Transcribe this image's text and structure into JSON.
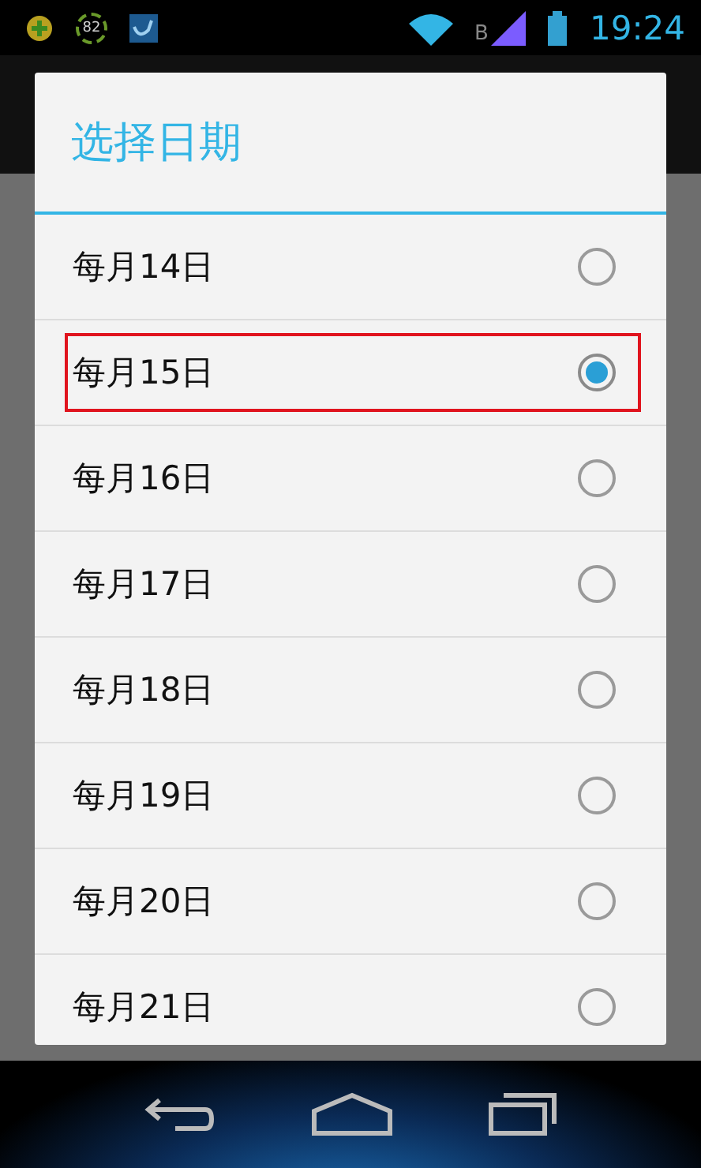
{
  "status_bar": {
    "battery_badge": "82",
    "network_letter": "B",
    "time": "19:24"
  },
  "dialog": {
    "title": "选择日期",
    "options": [
      {
        "label": "每月14日",
        "selected": false,
        "highlighted": false
      },
      {
        "label": "每月15日",
        "selected": true,
        "highlighted": true
      },
      {
        "label": "每月16日",
        "selected": false,
        "highlighted": false
      },
      {
        "label": "每月17日",
        "selected": false,
        "highlighted": false
      },
      {
        "label": "每月18日",
        "selected": false,
        "highlighted": false
      },
      {
        "label": "每月19日",
        "selected": false,
        "highlighted": false
      },
      {
        "label": "每月20日",
        "selected": false,
        "highlighted": false
      },
      {
        "label": "每月21日",
        "selected": false,
        "highlighted": false
      }
    ]
  }
}
